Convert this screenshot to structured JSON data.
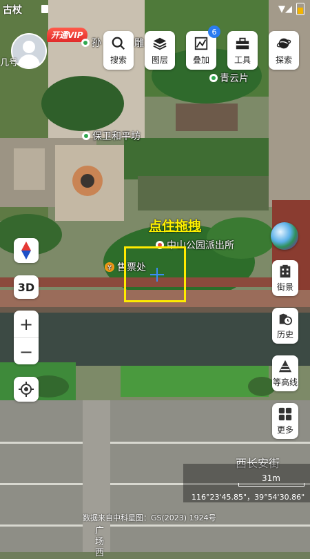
{
  "status_bar": {
    "time_fragment": "古杖",
    "signal": "▼◢",
    "battery_level_fraction": 0.6
  },
  "user": {
    "vip_label": "开通VIP",
    "caption": "几号"
  },
  "top_tools": [
    {
      "label": "搜索",
      "icon": "search-icon"
    },
    {
      "label": "图层",
      "icon": "layers-icon"
    },
    {
      "label": "叠加",
      "icon": "overlay-icon",
      "badge": "6"
    },
    {
      "label": "工具",
      "icon": "toolbox-icon"
    },
    {
      "label": "探索",
      "icon": "planet-icon"
    }
  ],
  "poi": {
    "top_left": "孙",
    "top_partial": "雕",
    "qingyunpian": "青云片",
    "baowei_heping_fang": "保卫和平坊",
    "police_station": "中山公园派出所",
    "ticket_office": "售票处"
  },
  "hint": {
    "drag_label": "点住拖拽"
  },
  "left_controls": {
    "three_d": "3D",
    "zoom_in": "+",
    "zoom_out": "−"
  },
  "right_controls": [
    {
      "label": "街景",
      "icon": "street-view-icon"
    },
    {
      "label": "历史",
      "icon": "history-icon"
    },
    {
      "label": "等高线",
      "icon": "contour-icon"
    },
    {
      "label": "更多",
      "icon": "more-grid-icon"
    }
  ],
  "map_info": {
    "road_name": "西长安街",
    "scale": "31m",
    "coordinates": "116°23'45.85\"，39°54'30.86\"",
    "attribution": "数据来自中科星图：GS(2023) 1924号",
    "vertical_label": "广场西"
  },
  "colors": {
    "accent_blue": "#2a7cf0",
    "hint_yellow": "#ffeb00",
    "vip_red": "#e02a2a"
  }
}
